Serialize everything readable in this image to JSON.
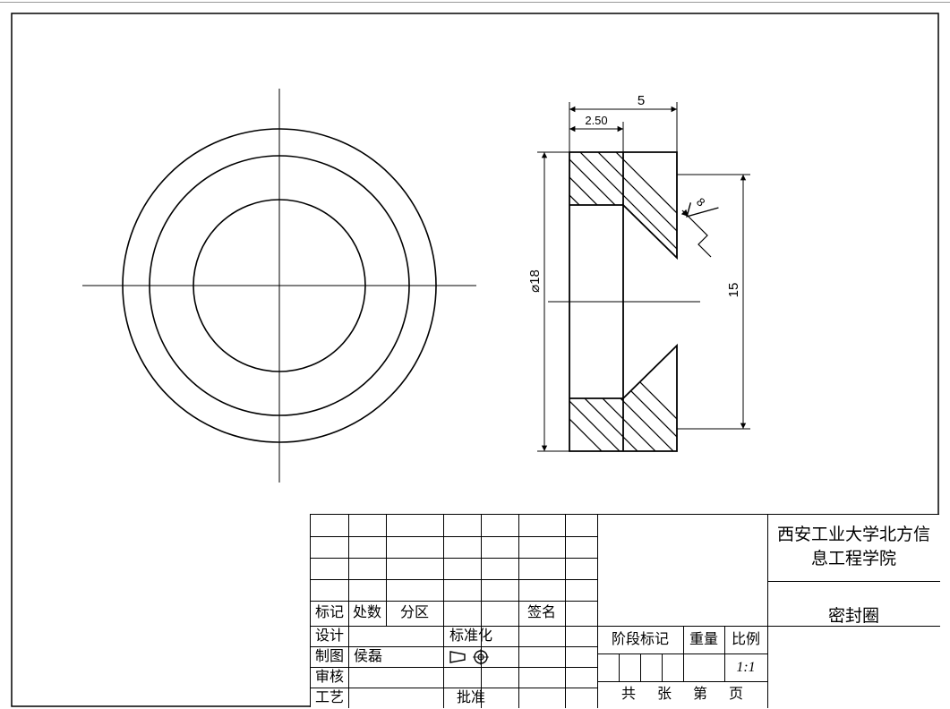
{
  "drawing": {
    "circles_view": {
      "diameters_mm": [
        18,
        15,
        10
      ],
      "center_cross": true
    },
    "section_view": {
      "dim_outer_diameter": "⌀18",
      "dim_inner_diameter_right": "15",
      "dim_width": "5",
      "dim_inner_width": "2.50",
      "rough_value": "8"
    }
  },
  "titleblock": {
    "rev_header": {
      "mark": "标记",
      "count": "处数",
      "zone": "分区",
      "sign": "签名"
    },
    "rows": {
      "design": "设计",
      "standardization": "标准化",
      "drawn": "制图",
      "drawn_by": "侯磊",
      "check": "审核",
      "process": "工艺",
      "approve": "批准"
    },
    "right": {
      "stage": "阶段标记",
      "weight": "重量",
      "scale_label": "比例",
      "scale_value": "1:1",
      "sheets_prefix": "共",
      "sheets_mid": "张",
      "this_sheet_prefix": "第",
      "this_sheet_suffix": "页"
    },
    "org": {
      "line1": "西安工业大学北方信",
      "line2": "息工程学院"
    },
    "part_name": "密封圈"
  },
  "chart_data": {
    "type": "table",
    "description": "Mechanical engineering drawing of a sealing ring (密封圈) — front view (concentric circles) and section view with hatch, plus GB-style title block.",
    "views": [
      {
        "name": "front",
        "geometry": "concentric circles",
        "diameters_mm": [
          18,
          15,
          10
        ]
      },
      {
        "name": "section",
        "geometry": "cross-section with 45° chamfer and hatching",
        "outer_diameter_mm": 18,
        "inner_step_diameter_mm": 15,
        "width_mm": 5,
        "step_width_mm": 2.5,
        "surface_roughness": 8
      }
    ],
    "scale": "1:1",
    "part_name_zh": "密封圈",
    "drawn_by": "侯磊",
    "organization_zh": "西安工业大学北方信息工程学院"
  }
}
